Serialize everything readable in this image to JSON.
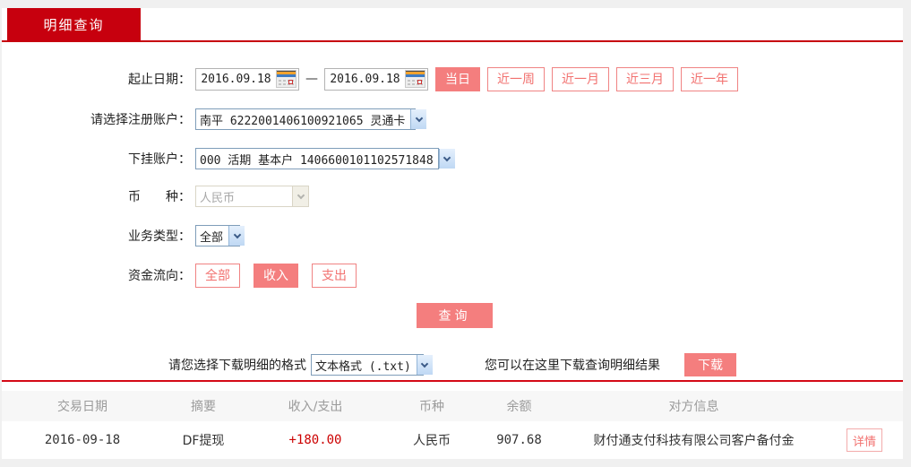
{
  "tab": {
    "label": "明细查询"
  },
  "form": {
    "date_range": {
      "label": "起止日期：",
      "start": "2016.09.18",
      "end": "2016.09.18",
      "separator": "—",
      "quick_buttons": [
        {
          "label": "当日",
          "active": true
        },
        {
          "label": "近一周",
          "active": false
        },
        {
          "label": "近一月",
          "active": false
        },
        {
          "label": "近三月",
          "active": false
        },
        {
          "label": "近一年",
          "active": false
        }
      ]
    },
    "register_account": {
      "label": "请选择注册账户：",
      "value": "南平 6222001406100921065 灵通卡"
    },
    "sub_account": {
      "label": "下挂账户：",
      "value": "000 活期 基本户 1406600101102571848"
    },
    "currency": {
      "label": "币　　种：",
      "value": "人民币",
      "disabled": true
    },
    "business_type": {
      "label": "业务类型：",
      "value": "全部"
    },
    "fund_flow": {
      "label": "资金流向：",
      "options": [
        {
          "label": "全部",
          "active": false
        },
        {
          "label": "收入",
          "active": true
        },
        {
          "label": "支出",
          "active": false
        }
      ]
    },
    "query_button": "查询"
  },
  "download": {
    "format_label": "请您选择下载明细的格式",
    "format_value": "文本格式 (.txt)",
    "hint": "您可以在这里下载查询明细结果",
    "button": "下载"
  },
  "table": {
    "headers": [
      "交易日期",
      "摘要",
      "收入/支出",
      "币种",
      "余额",
      "对方信息"
    ],
    "rows": [
      {
        "date": "2016-09-18",
        "summary": "DF提现",
        "amount": "+180.00",
        "currency": "人民币",
        "balance": "907.68",
        "counterparty": "财付通支付科技有限公司客户备付金",
        "detail_label": "详情"
      }
    ]
  },
  "colors": {
    "accent_red": "#c7000e",
    "button_pink": "#f47e7e",
    "amount_red": "#cc0000"
  }
}
